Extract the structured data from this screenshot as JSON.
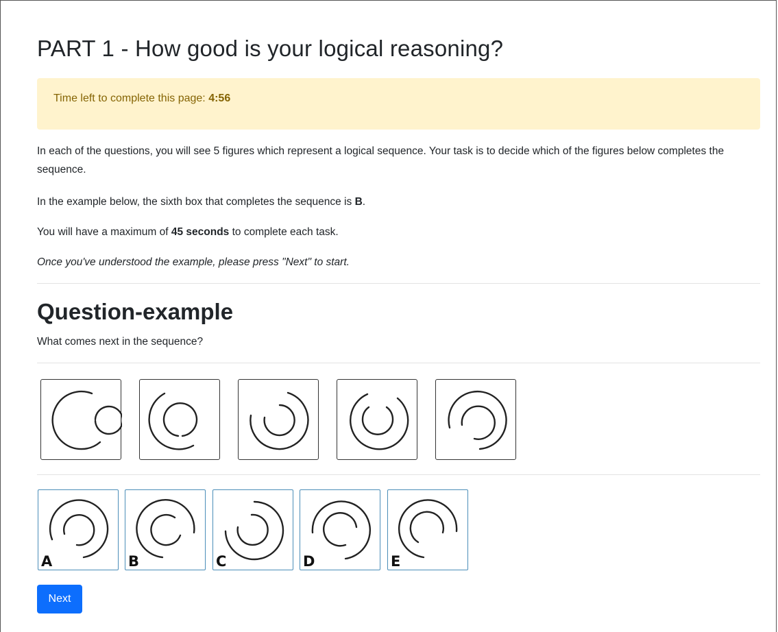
{
  "page": {
    "title": "PART 1 - How good is your logical reasoning?",
    "timer": {
      "label": "Time left to complete this page:",
      "value": "4:56"
    },
    "instructions": {
      "p1": "In each of the questions, you will see 5 figures which represent a logical sequence. Your task is to decide which of the figures below completes the sequence.",
      "p2_pre": "In the example below, the sixth box that completes the sequence is ",
      "p2_bold": "B",
      "p2_post": ".",
      "p3_pre": "You will have a maximum of ",
      "p3_bold": "45 seconds",
      "p3_post": " to complete each task.",
      "p4": "Once you've understood the example, please press \"Next\" to start."
    }
  },
  "question": {
    "title": "Question-example",
    "prompt": "What comes next in the sequence?",
    "sequence_figures": [
      "two-arcs-figure",
      "two-arcs-figure",
      "two-arcs-figure",
      "two-arcs-figure",
      "two-arcs-figure"
    ],
    "options": [
      {
        "letter": "A"
      },
      {
        "letter": "B"
      },
      {
        "letter": "C"
      },
      {
        "letter": "D"
      },
      {
        "letter": "E"
      }
    ]
  },
  "actions": {
    "next_label": "Next"
  },
  "colors": {
    "alert_bg": "#fff3cd",
    "alert_text": "#856404",
    "primary": "#0d6efd",
    "option_border": "#4a8db8"
  }
}
